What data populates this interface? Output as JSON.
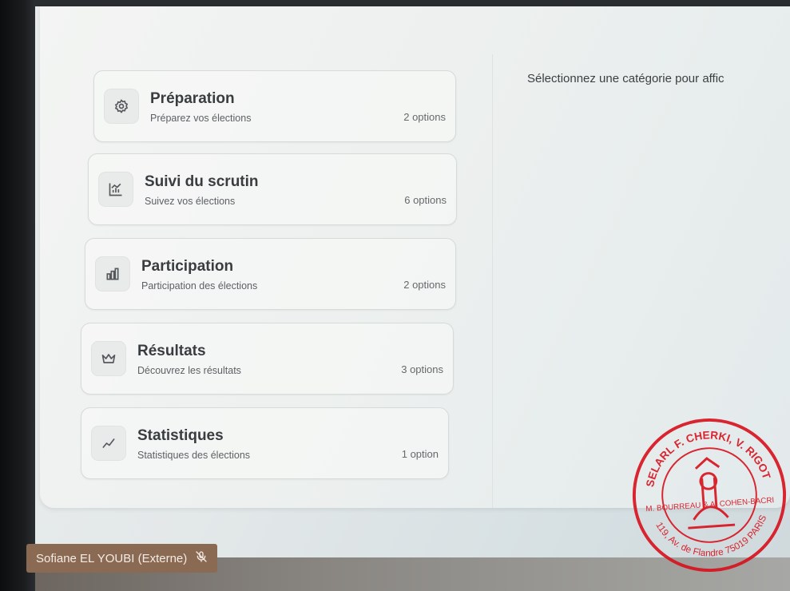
{
  "main": {
    "hint": "Sélectionnez une catégorie pour affic"
  },
  "categories": [
    {
      "title": "Préparation",
      "subtitle": "Préparez vos élections",
      "count": "2 options",
      "icon": "settings-icon"
    },
    {
      "title": "Suivi du scrutin",
      "subtitle": "Suivez vos élections",
      "count": "6 options",
      "icon": "bar-chart-icon"
    },
    {
      "title": "Participation",
      "subtitle": "Participation des élections",
      "count": "2 options",
      "icon": "bar-chart-2-icon"
    },
    {
      "title": "Résultats",
      "subtitle": "Découvrez les résultats",
      "count": "3 options",
      "icon": "crown-icon"
    },
    {
      "title": "Statistiques",
      "subtitle": "Statistiques des élections",
      "count": "1 option",
      "icon": "trend-icon"
    }
  ],
  "participant": {
    "name": "Sofiane EL YOUBI (Externe)",
    "icon": "mic-muted-icon"
  },
  "stamp": {
    "text": "SELARL F. CHERKI, V. RIGOT M. BOURREAU & A. COHEN-BACRI Commissaires de Justice associés 119, Av. de Flandre 75019 PARIS",
    "color": "#d8101c"
  },
  "colors": {
    "name_tag_bg": "#8a6a52"
  }
}
